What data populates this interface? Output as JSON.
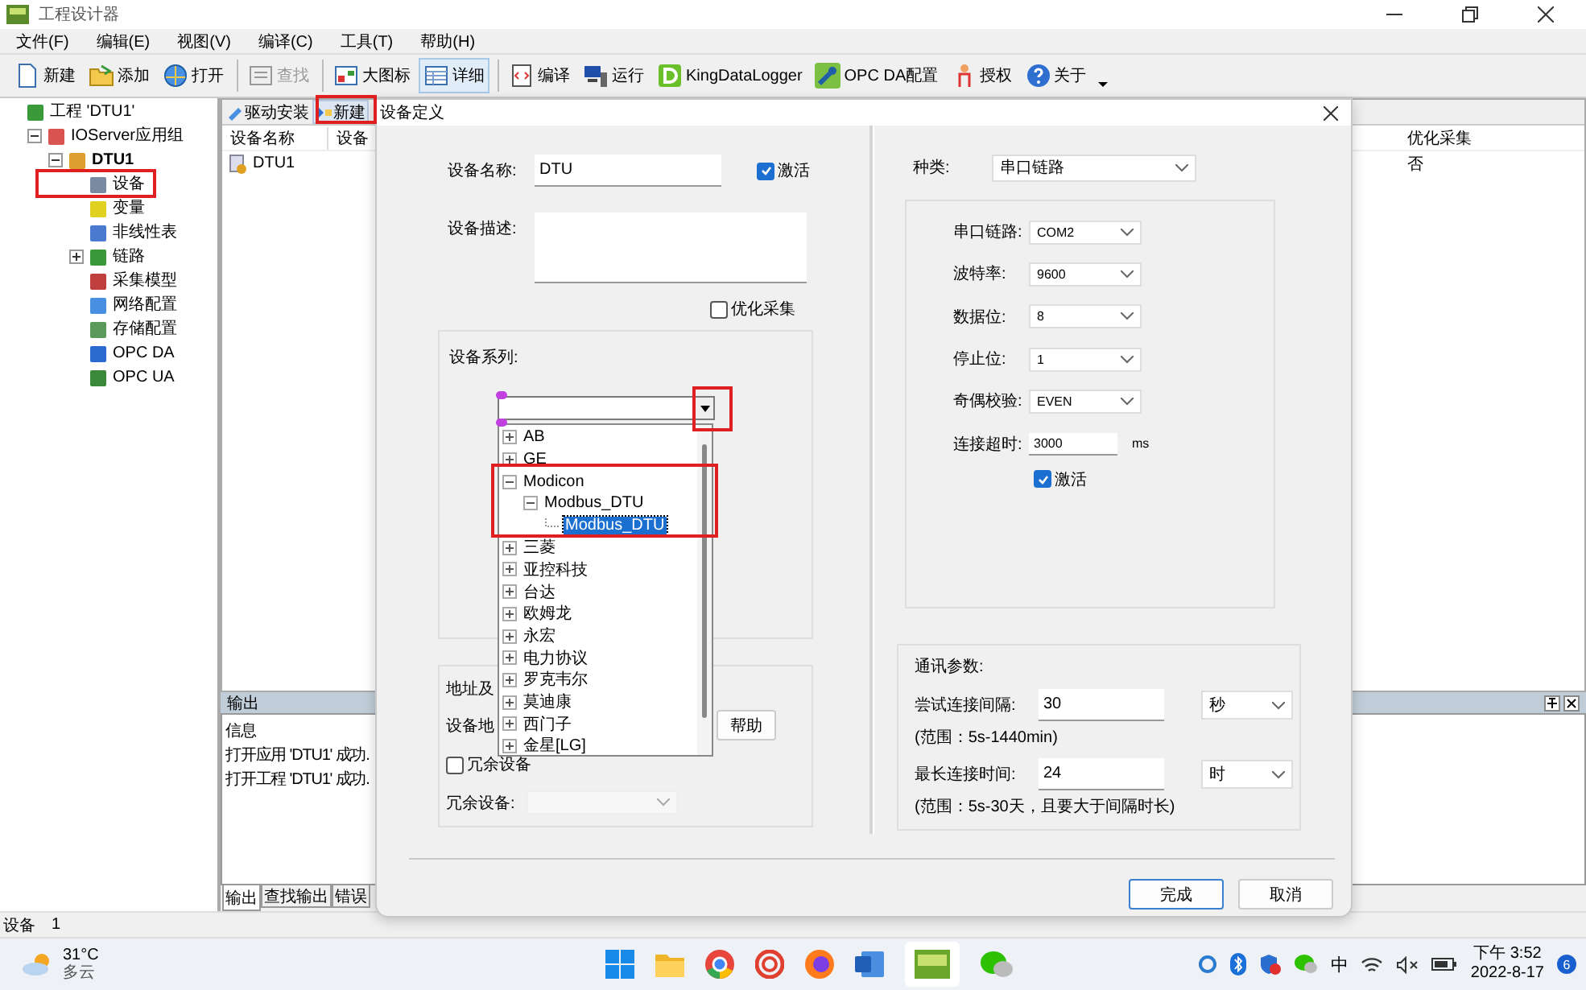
{
  "window": {
    "title": "工程设计器"
  },
  "menu": [
    "文件(F)",
    "编辑(E)",
    "视图(V)",
    "编译(C)",
    "工具(T)",
    "帮助(H)"
  ],
  "toolbar": [
    {
      "label": "新建",
      "disabled": false,
      "pressed": false
    },
    {
      "label": "添加",
      "disabled": false,
      "pressed": false
    },
    {
      "label": "打开",
      "disabled": false,
      "pressed": false
    },
    {
      "label": "查找",
      "disabled": true,
      "pressed": false
    },
    {
      "label": "大图标",
      "disabled": false,
      "pressed": false
    },
    {
      "label": "详细",
      "disabled": false,
      "pressed": true
    },
    {
      "label": "编译",
      "disabled": false,
      "pressed": false
    },
    {
      "label": "运行",
      "disabled": false,
      "pressed": false
    },
    {
      "label": "KingDataLogger",
      "disabled": false,
      "pressed": false
    },
    {
      "label": "OPC DA配置",
      "disabled": false,
      "pressed": false
    },
    {
      "label": "授权",
      "disabled": false,
      "pressed": false
    },
    {
      "label": "关于",
      "disabled": false,
      "pressed": false
    }
  ],
  "tree": [
    {
      "label": "工程 'DTU1'",
      "children": [
        {
          "label": "IOServer应用组",
          "expanded": true,
          "children": [
            {
              "label": "DTU1",
              "bold": true,
              "expanded": true,
              "children": [
                {
                  "label": "设备"
                },
                {
                  "label": "变量"
                },
                {
                  "label": "非线性表"
                },
                {
                  "label": "链路",
                  "expanded": false
                },
                {
                  "label": "采集模型"
                },
                {
                  "label": "网络配置"
                },
                {
                  "label": "存储配置"
                },
                {
                  "label": "OPC DA"
                },
                {
                  "label": "OPC UA"
                }
              ]
            }
          ]
        }
      ]
    }
  ],
  "device_list": {
    "tabs": [
      {
        "label": "驱动安装",
        "selected": false
      },
      {
        "label": "新建",
        "selected": true
      }
    ],
    "columns": [
      "设备名称",
      "设备",
      "优化采集"
    ],
    "rows": [
      {
        "name": "DTU1",
        "optimize": "否"
      }
    ]
  },
  "output": {
    "title": "输出",
    "header": "信息",
    "lines": [
      "打开应用 'DTU1' 成功.",
      "打开工程 'DTU1' 成功."
    ],
    "tabs": [
      {
        "label": "输出",
        "selected": true
      },
      {
        "label": "查找输出",
        "selected": false
      },
      {
        "label": "错误",
        "selected": false
      }
    ]
  },
  "status_bar": {
    "label": "设备",
    "count": "1"
  },
  "dialog": {
    "title": "设备定义",
    "name_label": "设备名称:",
    "name_value": "DTU",
    "active_label": "激活",
    "active": true,
    "desc_label": "设备描述:",
    "optimize_label": "优化采集",
    "optimize": false,
    "series_label": "设备系列:",
    "series_tree": [
      {
        "label": "AB",
        "expanded": false
      },
      {
        "label": "GE",
        "expanded": false
      },
      {
        "label": "Modicon",
        "expanded": true,
        "children": [
          {
            "label": "Modbus_DTU",
            "expanded": true,
            "children": [
              {
                "label": "Modbus_DTU",
                "selected": true
              }
            ]
          }
        ]
      },
      {
        "label": "三菱",
        "expanded": false
      },
      {
        "label": "亚控科技",
        "expanded": false
      },
      {
        "label": "台达",
        "expanded": false
      },
      {
        "label": "欧姆龙",
        "expanded": false
      },
      {
        "label": "永宏",
        "expanded": false
      },
      {
        "label": "电力协议",
        "expanded": false
      },
      {
        "label": "罗克韦尔",
        "expanded": false
      },
      {
        "label": "莫迪康",
        "expanded": false
      },
      {
        "label": "西门子",
        "expanded": false
      },
      {
        "label": "金星[LG]",
        "expanded": false
      }
    ],
    "addr_group_label": "地址及",
    "addr_label": "设备地",
    "help_button": "帮助",
    "redundant_label": "冗余设备",
    "redundant": false,
    "redundant_device_label": "冗余设备:",
    "type_label": "种类:",
    "type_value": "串口链路",
    "link_fields": [
      {
        "label": "串口链路:",
        "value": "COM2",
        "kind": "combo"
      },
      {
        "label": "波特率:",
        "value": "9600",
        "kind": "combo"
      },
      {
        "label": "数据位:",
        "value": "8",
        "kind": "combo"
      },
      {
        "label": "停止位:",
        "value": "1",
        "kind": "combo"
      },
      {
        "label": "奇偶校验:",
        "value": "EVEN",
        "kind": "combo"
      },
      {
        "label": "连接超时:",
        "value": "3000",
        "kind": "input",
        "unit": "ms"
      }
    ],
    "link_active_label": "激活",
    "link_active": true,
    "comm_label": "通讯参数:",
    "comm_fields": [
      {
        "label": "尝试连接间隔:",
        "value": "30",
        "unit": "秒",
        "range": "(范围：5s-1440min)"
      },
      {
        "label": "最长连接时间:",
        "value": "24",
        "unit": "时",
        "range": "(范围：5s-30天，且要大于间隔时长)"
      }
    ],
    "buttons": [
      {
        "label": "完成",
        "default": true
      },
      {
        "label": "取消",
        "default": false
      }
    ]
  },
  "taskbar": {
    "temperature": "31°C",
    "weather": "多云",
    "ime": "中",
    "time": "下午 3:52",
    "date": "2022-8-17",
    "badge": "6"
  }
}
